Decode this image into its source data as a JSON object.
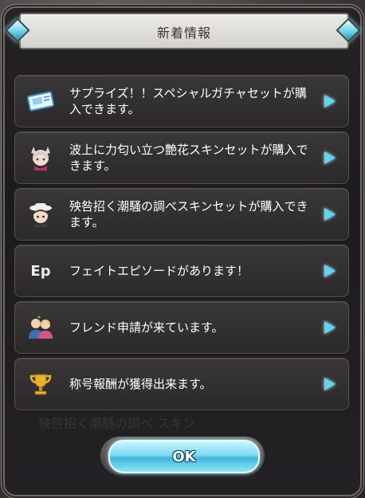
{
  "dialog": {
    "title": "新着情報",
    "ok_label": "OK"
  },
  "items": [
    {
      "icon": "ticket-icon",
      "text": "サプライズ！！スペシャルガチャセットが購入できます。"
    },
    {
      "icon": "character-skin-icon",
      "text": "波上に力匂い立つ艶花スキンセットが購入できます。"
    },
    {
      "icon": "character-skin-icon",
      "text": "殃咎招く潮騒の調べスキンセットが購入できます。"
    },
    {
      "icon": "ep-icon",
      "icon_text": "Ep",
      "text": "フェイトエピソードがあります！"
    },
    {
      "icon": "friends-icon",
      "text": "フレンド申請が来ています。"
    },
    {
      "icon": "trophy-icon",
      "text": "称号報酬が獲得出来ます。"
    }
  ],
  "background_text": "殃咎招く潮騒の調べ スキン",
  "colors": {
    "accent": "#5fd3ef",
    "panel": "#2b292a",
    "title_bar": "#e0dfda"
  }
}
